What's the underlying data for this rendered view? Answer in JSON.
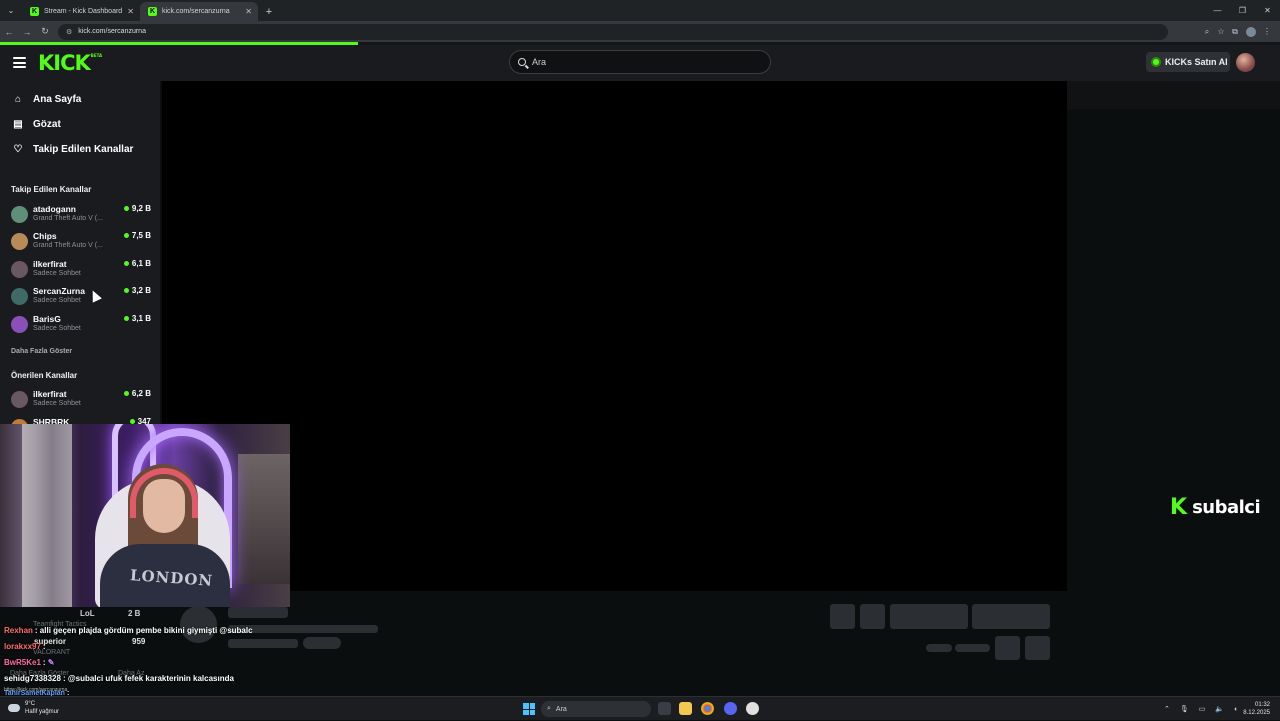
{
  "browser": {
    "tabs": [
      {
        "title": "Stream - Kick Dashboard",
        "active": false
      },
      {
        "title": "kick.com/sercanzurna",
        "active": true
      }
    ],
    "url": "kick.com/sercanzurna",
    "page_load_progress": 0.28
  },
  "header": {
    "logo": "KICK",
    "logo_badge": "BETA",
    "search_placeholder": "Ara",
    "kicks_button": "KICKs Satın Al"
  },
  "sidebar": {
    "nav": [
      {
        "label": "Ana Sayfa",
        "icon": "home-icon"
      },
      {
        "label": "Gözat",
        "icon": "browse-icon"
      },
      {
        "label": "Takip Edilen Kanallar",
        "icon": "heart-icon"
      }
    ],
    "followed_title": "Takip Edilen Kanallar",
    "followed": [
      {
        "name": "atadogann",
        "category": "Grand Theft Auto V (...",
        "viewers": "9,2 B",
        "color": "#5f8f7a"
      },
      {
        "name": "Chips",
        "category": "Grand Theft Auto V (...",
        "viewers": "7,5 B",
        "color": "#b88a5a"
      },
      {
        "name": "ilkerfirat",
        "category": "Sadece Sohbet",
        "viewers": "6,1 B",
        "color": "#6a5860"
      },
      {
        "name": "SercanZurna",
        "category": "Sadece Sohbet",
        "viewers": "3,2 B",
        "color": "#3f6a66"
      },
      {
        "name": "BarisG",
        "category": "Sadece Sohbet",
        "viewers": "3,1 B",
        "color": "#8a4fb8"
      }
    ],
    "show_more": "Daha Fazla Göster",
    "recommended_title": "Önerilen Kanallar",
    "recommended": [
      {
        "name": "ilkerfirat",
        "category": "Sadece Sohbet",
        "viewers": "6,2 B",
        "color": "#6a5860"
      },
      {
        "name": "SHRBRK",
        "category": "",
        "viewers": "347",
        "color": "#c07a3a"
      }
    ]
  },
  "stream": {
    "channel_watermark": "subalci"
  },
  "chat": [
    {
      "user": "Rexhan",
      "user_color": "#ff6b6b",
      "message": "alli geçen plajda gördüm pembe bikini giymişti @subalc"
    },
    {
      "user": "lorakxx97",
      "user_color": "#ff6b6b",
      "message": ""
    },
    {
      "user": "BwR5Ke1",
      "user_color": "#ff6b9c",
      "message": ""
    },
    {
      "user": "sehidg7338328",
      "user_color": "#ffffff",
      "message": "@subalci ufuk fefek karakterinin kalcasında"
    },
    {
      "user": "TahirSametKaplan",
      "user_color": "#5aa0ff",
      "message": ""
    }
  ],
  "ghost_texts": {
    "row1_name": "LoL",
    "row1_count": "2 B",
    "row1_sub": "Teamfight Tactics",
    "row2_name": "superior",
    "row2_count": "959",
    "row2_sub": "VALORANT",
    "row3_a": "Daha Fazla Göster",
    "row3_b": "Daha Az",
    "status_url": "https://kick.com/sercanzurna"
  },
  "weather": {
    "temp": "9°C",
    "desc": "Hafif yağmur"
  },
  "taskbar": {
    "search": "Ara",
    "time": "01:32",
    "date": "8.12.2025"
  },
  "colors": {
    "kick_green": "#53fc18",
    "background": "#0b0e0f",
    "panel": "#191b1f"
  }
}
